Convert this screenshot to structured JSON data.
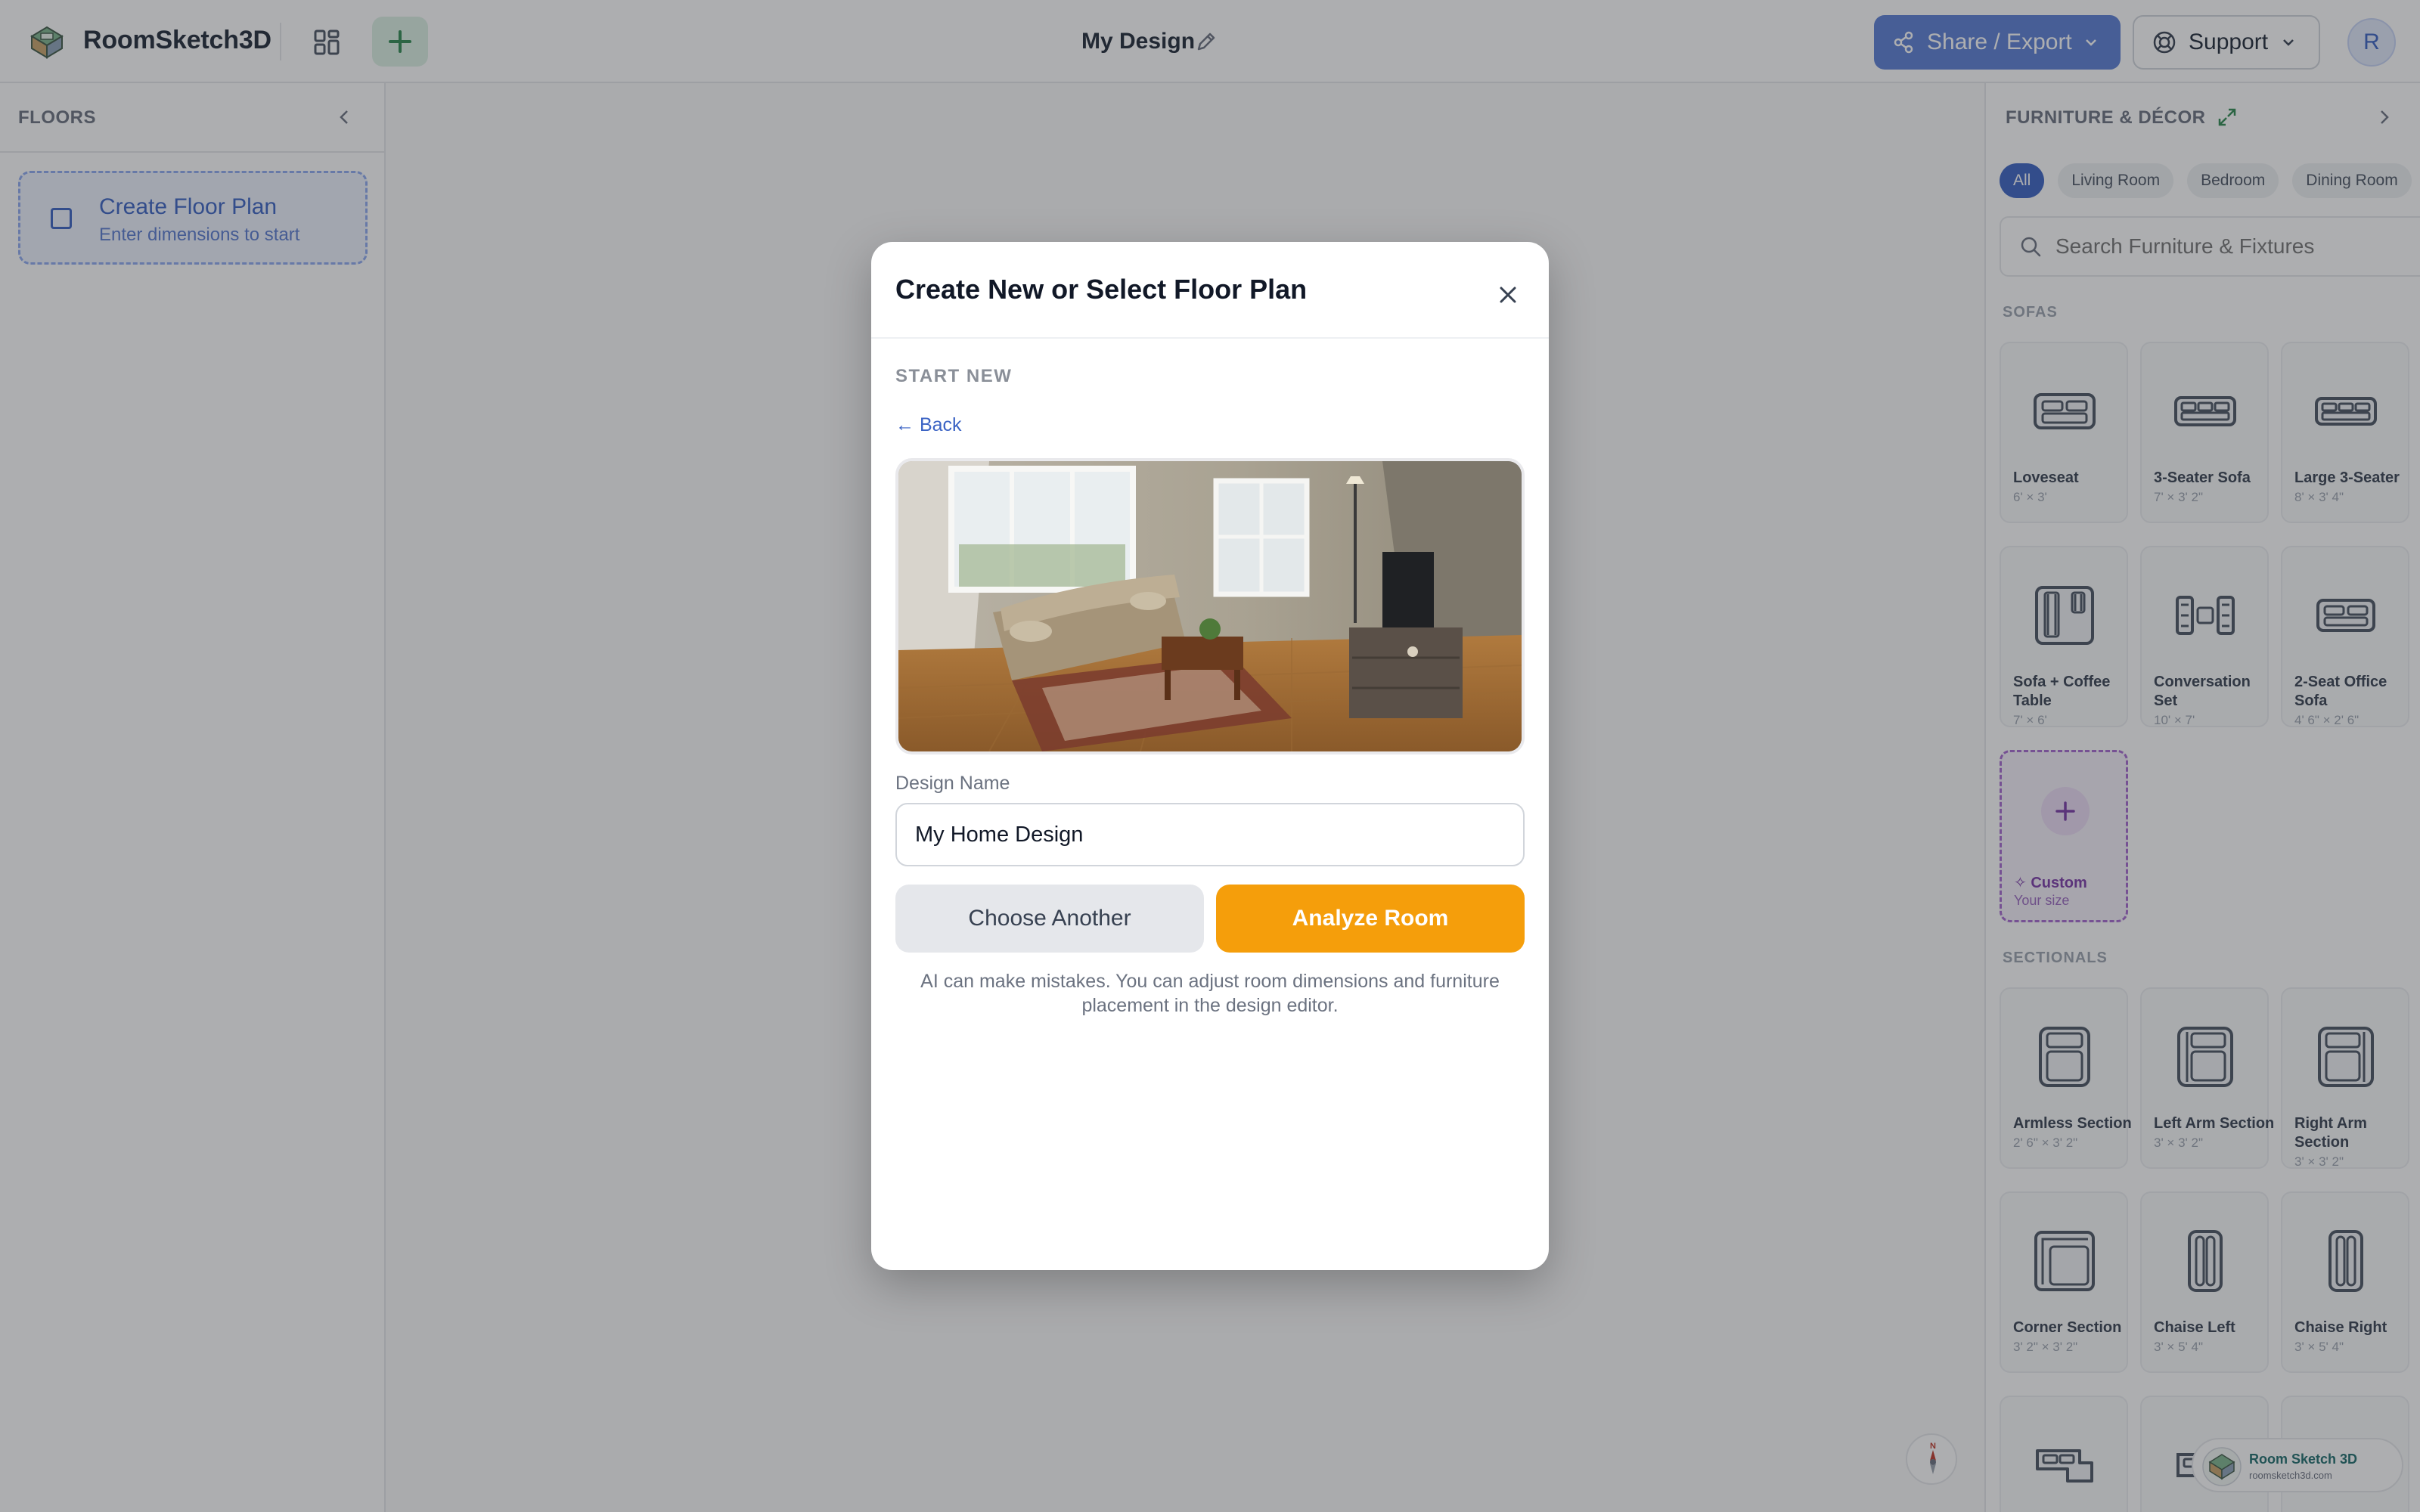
{
  "header": {
    "app_name": "RoomSketch3D",
    "design_title": "My Design",
    "share_label": "Share / Export",
    "support_label": "Support",
    "avatar_initial": "R"
  },
  "left_panel": {
    "title": "FLOORS",
    "create_card": {
      "title": "Create Floor Plan",
      "subtitle": "Enter dimensions to start"
    }
  },
  "right_panel": {
    "title": "FURNITURE & DÉCOR",
    "chips": [
      "All",
      "Living Room",
      "Bedroom",
      "Dining Room"
    ],
    "active_chip": "All",
    "search_placeholder": "Search Furniture & Fixtures",
    "sections": {
      "sofas": {
        "label": "SOFAS",
        "items": [
          {
            "name": "Loveseat",
            "dims": "6' × 3'"
          },
          {
            "name": "3-Seater Sofa",
            "dims": "7' × 3' 2\""
          },
          {
            "name": "Large 3-Seater",
            "dims": "8' × 3' 4\""
          },
          {
            "name": "Sofa + Coffee Table",
            "dims": "7' × 6'"
          },
          {
            "name": "Conversation Set",
            "dims": "10' × 7'"
          },
          {
            "name": "2-Seat Office Sofa",
            "dims": "4' 6\" × 2' 6\""
          }
        ],
        "custom": {
          "title": "Custom",
          "subtitle": "Your size"
        }
      },
      "sectionals": {
        "label": "SECTIONALS",
        "items": [
          {
            "name": "Armless Section",
            "dims": "2' 6\" × 3' 2\""
          },
          {
            "name": "Left Arm Section",
            "dims": "3' × 3' 2\""
          },
          {
            "name": "Right Arm Section",
            "dims": "3' × 3' 2\""
          },
          {
            "name": "Corner Section",
            "dims": "3' 2\" × 3' 2\""
          },
          {
            "name": "Chaise Left",
            "dims": "3' × 5' 4\""
          },
          {
            "name": "Chaise Right",
            "dims": "3' × 5' 4\""
          }
        ]
      }
    }
  },
  "watermark": {
    "name": "Room Sketch 3D",
    "url": "roomsketch3d.com"
  },
  "modal": {
    "title": "Create New or Select Floor Plan",
    "section_label": "START NEW",
    "back_label": "← Back",
    "photo_icon": "living-room-photo",
    "field_label": "Design Name",
    "design_name_value": "My Home Design",
    "choose_label": "Choose Another",
    "analyze_label": "Analyze Room",
    "disclaimer": "AI can make mistakes. You can adjust room dimensions and furniture placement in the design editor."
  },
  "colors": {
    "accent_blue": "#3b63c4",
    "share_blue": "#5b7fd6",
    "analyze_orange": "#f59e0b",
    "custom_purple": "#a66ad1"
  }
}
